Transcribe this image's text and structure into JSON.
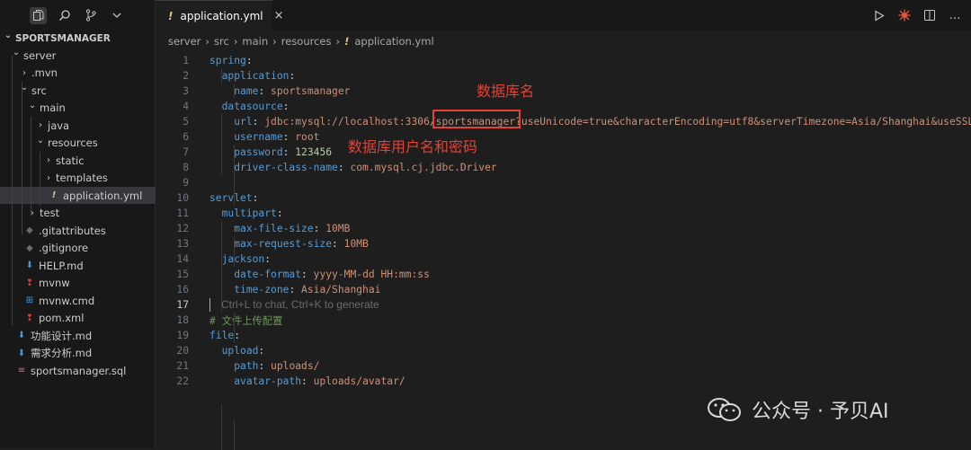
{
  "activity": {
    "icons": [
      "files-icon",
      "search-icon",
      "source-control-icon",
      "chevron-down-icon"
    ]
  },
  "explorer": {
    "project": "SPORTSMANAGER",
    "items": [
      {
        "label": "server",
        "depth": 1,
        "type": "folder",
        "expanded": true
      },
      {
        "label": ".mvn",
        "depth": 2,
        "type": "folder",
        "expanded": false
      },
      {
        "label": "src",
        "depth": 2,
        "type": "folder",
        "expanded": true
      },
      {
        "label": "main",
        "depth": 3,
        "type": "folder",
        "expanded": true
      },
      {
        "label": "java",
        "depth": 4,
        "type": "folder",
        "expanded": false
      },
      {
        "label": "resources",
        "depth": 4,
        "type": "folder",
        "expanded": true
      },
      {
        "label": "static",
        "depth": 5,
        "type": "folder",
        "expanded": false
      },
      {
        "label": "templates",
        "depth": 5,
        "type": "folder",
        "expanded": false
      },
      {
        "label": "application.yml",
        "depth": 5,
        "type": "yml",
        "selected": true
      },
      {
        "label": "test",
        "depth": 3,
        "type": "folder",
        "expanded": false
      },
      {
        "label": ".gitattributes",
        "depth": 2,
        "type": "git"
      },
      {
        "label": ".gitignore",
        "depth": 2,
        "type": "git"
      },
      {
        "label": "HELP.md",
        "depth": 2,
        "type": "md"
      },
      {
        "label": "mvnw",
        "depth": 2,
        "type": "mvn"
      },
      {
        "label": "mvnw.cmd",
        "depth": 2,
        "type": "cmd"
      },
      {
        "label": "pom.xml",
        "depth": 2,
        "type": "mvn"
      },
      {
        "label": "功能设计.md",
        "depth": 1,
        "type": "md"
      },
      {
        "label": "需求分析.md",
        "depth": 1,
        "type": "md"
      },
      {
        "label": "sportsmanager.sql",
        "depth": 1,
        "type": "sql"
      }
    ]
  },
  "tab": {
    "bang": "!",
    "label": "application.yml",
    "close": "×"
  },
  "breadcrumb": {
    "parts": [
      "server",
      "src",
      "main",
      "resources"
    ],
    "bang": "!",
    "file": "application.yml"
  },
  "code": {
    "lines": [
      [
        {
          "t": "k",
          "s": "spring"
        },
        {
          "t": "p",
          "s": ":"
        }
      ],
      [
        {
          "t": "p",
          "s": "  "
        },
        {
          "t": "k",
          "s": "application"
        },
        {
          "t": "p",
          "s": ":"
        }
      ],
      [
        {
          "t": "p",
          "s": "    "
        },
        {
          "t": "k",
          "s": "name"
        },
        {
          "t": "p",
          "s": ": "
        },
        {
          "t": "v",
          "s": "sportsmanager"
        }
      ],
      [
        {
          "t": "p",
          "s": "  "
        },
        {
          "t": "k",
          "s": "datasource"
        },
        {
          "t": "p",
          "s": ":"
        }
      ],
      [
        {
          "t": "p",
          "s": "    "
        },
        {
          "t": "k",
          "s": "url"
        },
        {
          "t": "p",
          "s": ": "
        },
        {
          "t": "v",
          "s": "jdbc:mysql://localhost:3306/sportsmanager?useUnicode=true&characterEncoding=utf8&serverTimezone=Asia/Shanghai&useSSL"
        }
      ],
      [
        {
          "t": "p",
          "s": "    "
        },
        {
          "t": "k",
          "s": "username"
        },
        {
          "t": "p",
          "s": ": "
        },
        {
          "t": "v",
          "s": "root"
        }
      ],
      [
        {
          "t": "p",
          "s": "    "
        },
        {
          "t": "k",
          "s": "password"
        },
        {
          "t": "p",
          "s": ": "
        },
        {
          "t": "n",
          "s": "123456"
        }
      ],
      [
        {
          "t": "p",
          "s": "    "
        },
        {
          "t": "k",
          "s": "driver-class-name"
        },
        {
          "t": "p",
          "s": ": "
        },
        {
          "t": "v",
          "s": "com.mysql.cj.jdbc.Driver"
        }
      ],
      [],
      [
        {
          "t": "k",
          "s": "servlet"
        },
        {
          "t": "p",
          "s": ":"
        }
      ],
      [
        {
          "t": "p",
          "s": "  "
        },
        {
          "t": "k",
          "s": "multipart"
        },
        {
          "t": "p",
          "s": ":"
        }
      ],
      [
        {
          "t": "p",
          "s": "    "
        },
        {
          "t": "k",
          "s": "max-file-size"
        },
        {
          "t": "p",
          "s": ": "
        },
        {
          "t": "v",
          "s": "10MB"
        }
      ],
      [
        {
          "t": "p",
          "s": "    "
        },
        {
          "t": "k",
          "s": "max-request-size"
        },
        {
          "t": "p",
          "s": ": "
        },
        {
          "t": "v",
          "s": "10MB"
        }
      ],
      [
        {
          "t": "p",
          "s": "  "
        },
        {
          "t": "k",
          "s": "jackson"
        },
        {
          "t": "p",
          "s": ":"
        }
      ],
      [
        {
          "t": "p",
          "s": "    "
        },
        {
          "t": "k",
          "s": "date-format"
        },
        {
          "t": "p",
          "s": ": "
        },
        {
          "t": "v",
          "s": "yyyy-MM-dd HH:mm:ss"
        }
      ],
      [
        {
          "t": "p",
          "s": "    "
        },
        {
          "t": "k",
          "s": "time-zone"
        },
        {
          "t": "p",
          "s": ": "
        },
        {
          "t": "v",
          "s": "Asia/Shanghai"
        }
      ],
      [
        {
          "t": "cursor",
          "s": ""
        },
        {
          "t": "h",
          "s": "Ctrl+L to chat, Ctrl+K to generate"
        }
      ],
      [
        {
          "t": "c",
          "s": "# 文件上传配置"
        }
      ],
      [
        {
          "t": "k",
          "s": "file"
        },
        {
          "t": "p",
          "s": ":"
        }
      ],
      [
        {
          "t": "p",
          "s": "  "
        },
        {
          "t": "k",
          "s": "upload"
        },
        {
          "t": "p",
          "s": ":"
        }
      ],
      [
        {
          "t": "p",
          "s": "    "
        },
        {
          "t": "k",
          "s": "path"
        },
        {
          "t": "p",
          "s": ": "
        },
        {
          "t": "v",
          "s": "uploads/"
        }
      ],
      [
        {
          "t": "p",
          "s": "    "
        },
        {
          "t": "k",
          "s": "avatar-path"
        },
        {
          "t": "p",
          "s": ": "
        },
        {
          "t": "v",
          "s": "uploads/avatar/"
        }
      ]
    ],
    "current_line": 17
  },
  "annotations": {
    "db_name": "数据库名",
    "db_user_pass": "数据库用户名和密码"
  },
  "watermark": {
    "text": "公众号 · 予贝AI"
  },
  "colors": {
    "annotation": "#e34235",
    "key": "#569cd6",
    "string": "#ce9178",
    "number": "#b5cea8",
    "comment": "#6a9955"
  }
}
